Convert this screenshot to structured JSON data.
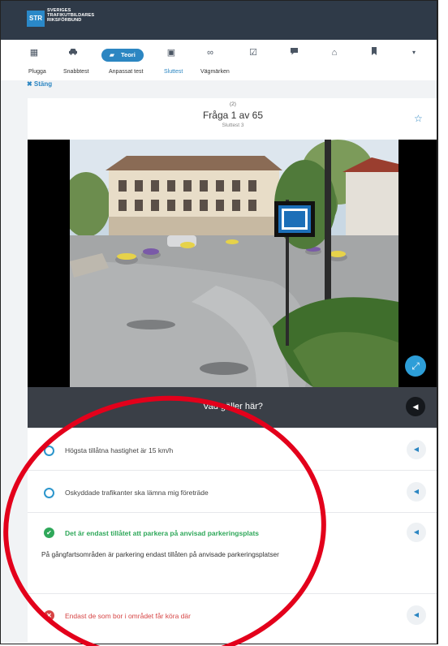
{
  "brand": {
    "logo_mark": "STR",
    "line1": "SVERIGES",
    "line2": "TRAFIKUTBILDARES",
    "line3": "RIKSFÖRBUND"
  },
  "nav": {
    "icons": [
      {
        "name": "grid-icon",
        "glyph": "▦"
      },
      {
        "name": "car-icon",
        "glyph": "🚗"
      },
      {
        "name": "calendar-icon",
        "glyph": "▣"
      },
      {
        "name": "link-icon",
        "glyph": "∞"
      },
      {
        "name": "checklist-icon",
        "glyph": "☑"
      },
      {
        "name": "chat-icon",
        "glyph": "✎"
      },
      {
        "name": "home-icon",
        "glyph": "⌂"
      },
      {
        "name": "bookmark-icon",
        "glyph": "▮"
      },
      {
        "name": "chevron-down-icon",
        "glyph": "▾"
      }
    ],
    "active_label": "Teori",
    "active_icon": "book-icon"
  },
  "subnav": {
    "tabs": [
      "Plugga",
      "Snabbtest",
      "Anpassat test",
      "Sluttest",
      "Vägmärken"
    ],
    "active_index": 3
  },
  "close_label": "✖ Stäng",
  "question": {
    "number_label": "(2)",
    "title": "Fråga 1 av 65",
    "subtitle": "Sluttest 3",
    "prompt": "Vad gäller här?"
  },
  "answers": [
    {
      "state": "neutral",
      "text": "Högsta tillåtna hastighet är 15 km/h"
    },
    {
      "state": "neutral",
      "text": "Oskyddade trafikanter ska lämna mig företräde"
    },
    {
      "state": "correct",
      "text": "Det är endast tillåtet att parkera på anvisad parkeringsplats",
      "explanation": "På gångfartsområden är parkering endast tillåten på anvisade parkeringsplatser"
    },
    {
      "state": "wrong",
      "text": "Endast de som bor i området får köra där"
    }
  ],
  "colors": {
    "accent": "#2c86c2",
    "correct": "#2fa85a",
    "wrong": "#d64545",
    "annotation_ring": "#e3001b"
  }
}
